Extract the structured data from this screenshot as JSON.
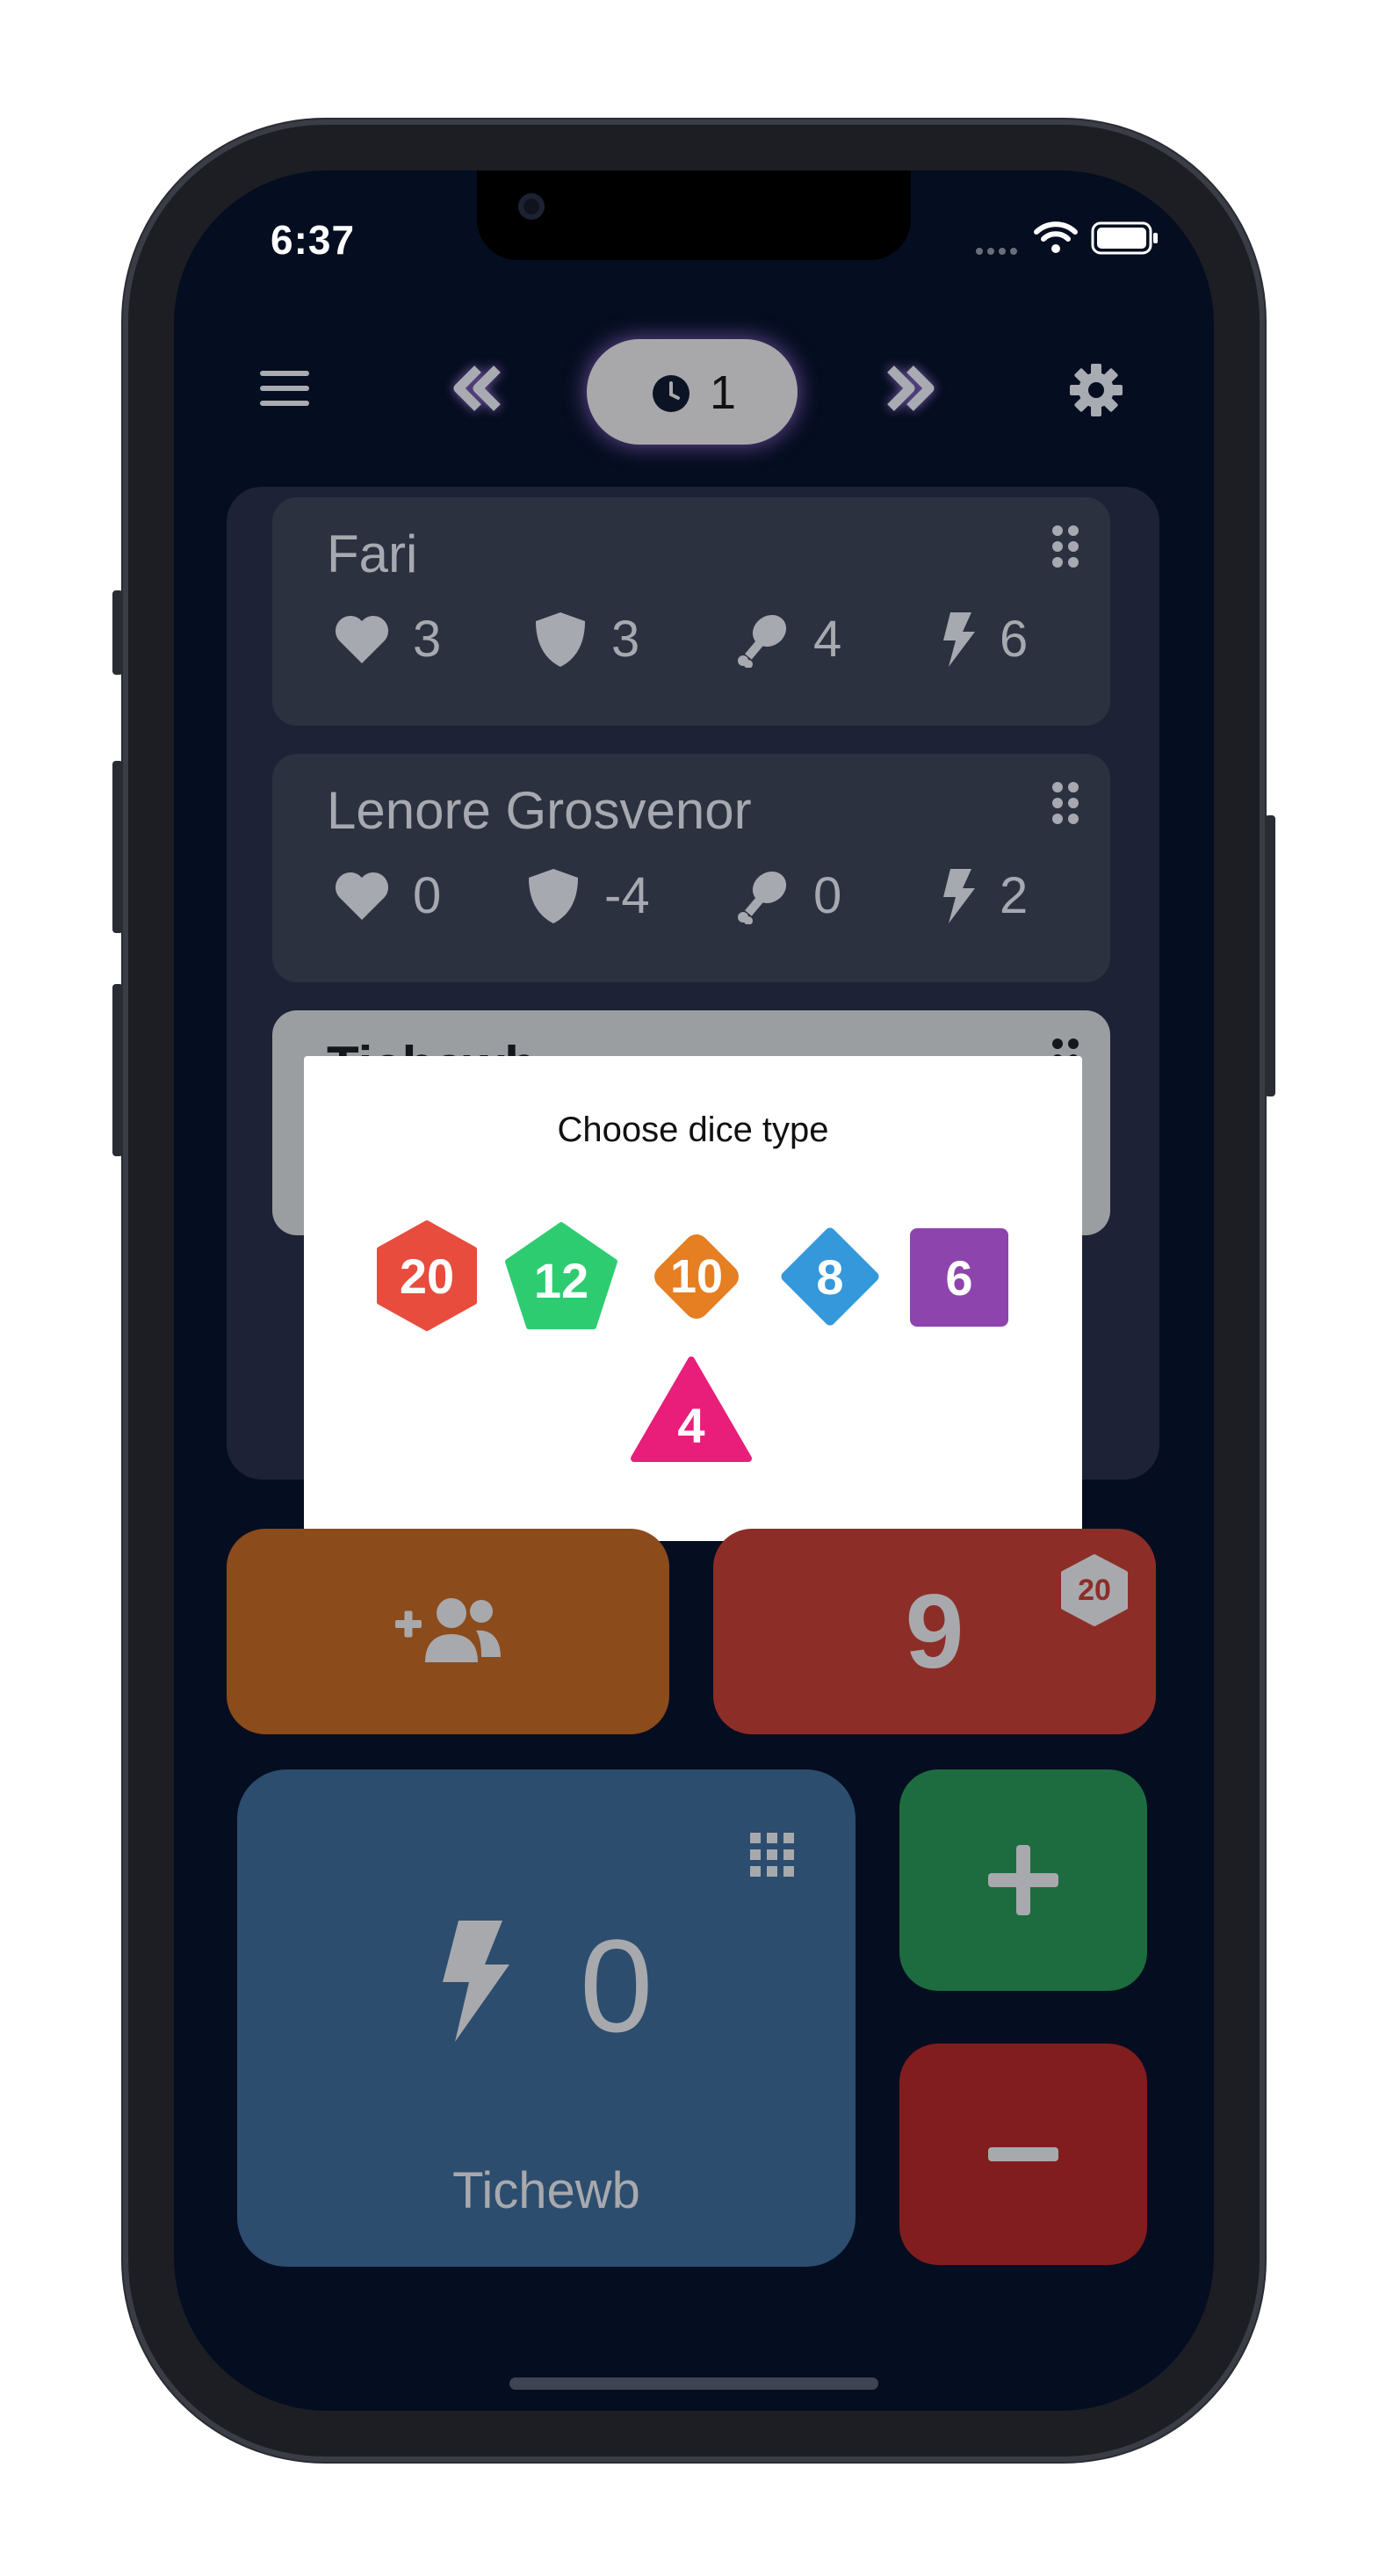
{
  "status_bar": {
    "time": "6:37"
  },
  "top_bar": {
    "menu_icon": "menu-icon",
    "prev_icon": "double-chevron-left-icon",
    "round": "1",
    "round_icon": "clock-icon",
    "next_icon": "double-chevron-right-icon",
    "settings_icon": "gear-icon"
  },
  "players": [
    {
      "name": "Fari",
      "health": "3",
      "armor": "3",
      "food": "4",
      "energy": "6"
    },
    {
      "name": "Lenore Grosvenor",
      "health": "0",
      "armor": "-4",
      "food": "0",
      "energy": "2"
    },
    {
      "name": "Tichewb"
    }
  ],
  "dice_dialog": {
    "title": "Choose dice type",
    "dice": [
      {
        "label": "20",
        "color": "#e74c3c",
        "shape": "hexagon"
      },
      {
        "label": "12",
        "color": "#2ecc71",
        "shape": "pentagon"
      },
      {
        "label": "10",
        "color": "#e67e22",
        "shape": "rounded-diamond"
      },
      {
        "label": "8",
        "color": "#3498db",
        "shape": "diamond"
      },
      {
        "label": "6",
        "color": "#8e44ad",
        "shape": "square"
      },
      {
        "label": "4",
        "color": "#e91e7a",
        "shape": "triangle"
      }
    ]
  },
  "controls": {
    "add_player_icon": "add-group-icon",
    "roll_value": "9",
    "roll_die_label": "20",
    "counter_value": "0",
    "counter_player": "Tichewb",
    "counter_icon": "bolt-icon",
    "plus_label": "+",
    "minus_label": "−"
  },
  "colors": {
    "background": "#050d20",
    "add_player": "#8b4b1b",
    "roll": "#8c2e27",
    "counter": "#2c4d6e",
    "plus": "#1c6c40",
    "minus": "#811d1e"
  }
}
